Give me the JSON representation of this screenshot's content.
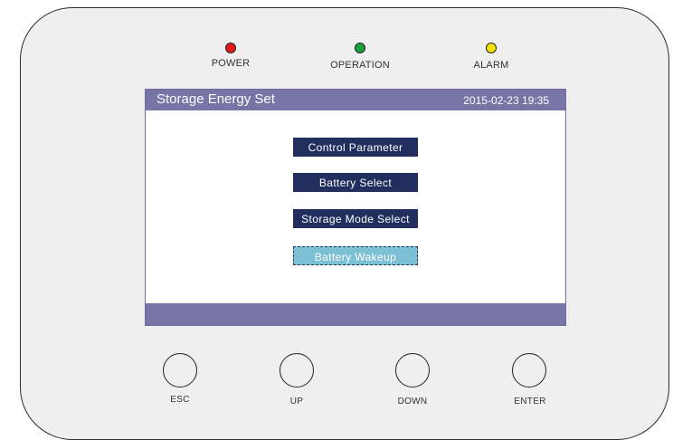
{
  "indicators": [
    {
      "label": "POWER",
      "color": "#e11b1b"
    },
    {
      "label": "OPERATION",
      "color": "#1aa23a"
    },
    {
      "label": "ALARM",
      "color": "#f2e600"
    }
  ],
  "screen": {
    "title": "Storage Energy Set",
    "datetime": "2015-02-23   19:35",
    "menu": [
      {
        "label": "Control Parameter",
        "selected": false
      },
      {
        "label": "Battery Select",
        "selected": false
      },
      {
        "label": "Storage Mode Select",
        "selected": false
      },
      {
        "label": "Battery Wakeup",
        "selected": true
      }
    ]
  },
  "keys": [
    "ESC",
    "UP",
    "DOWN",
    "ENTER"
  ]
}
